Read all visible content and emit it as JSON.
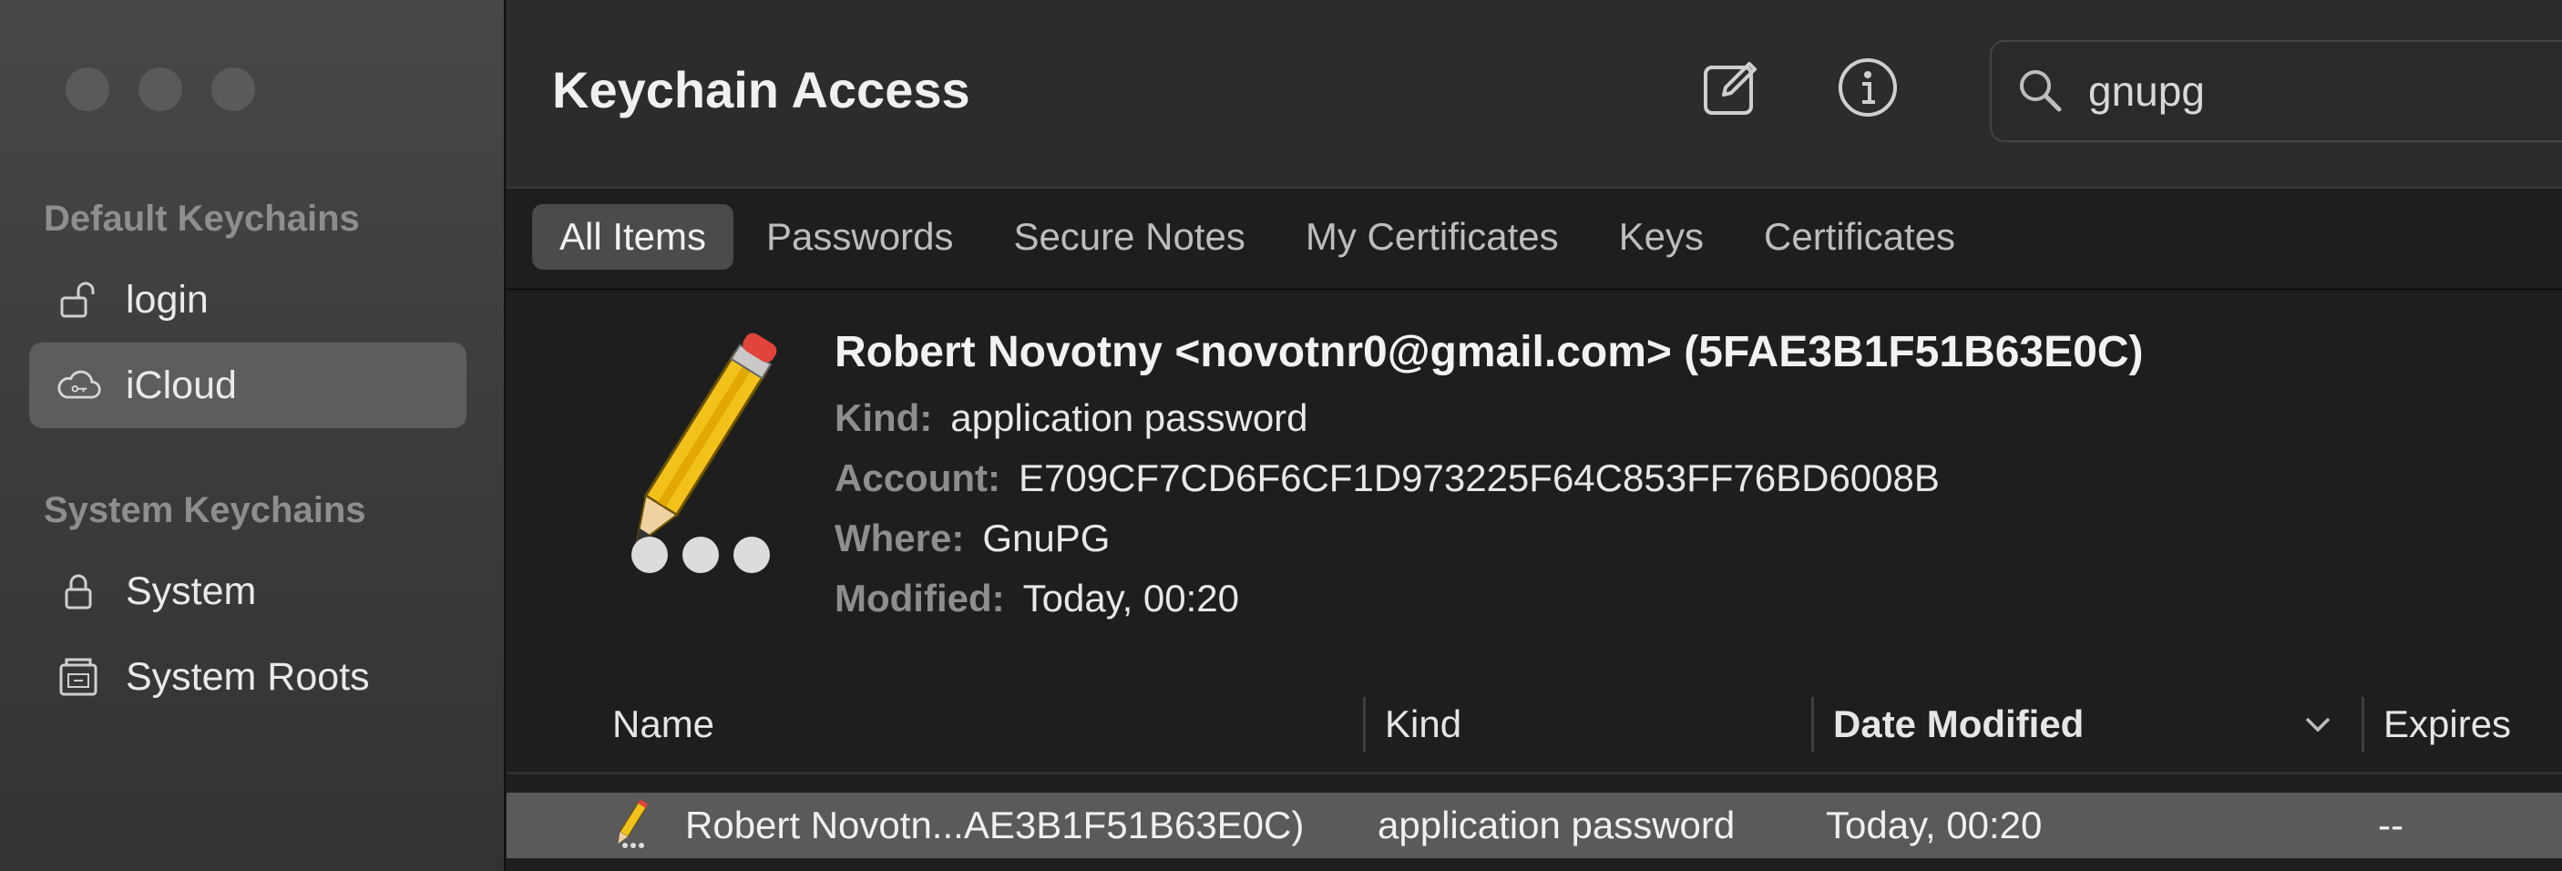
{
  "window": {
    "traffic_lights": [
      "close",
      "minimize",
      "zoom"
    ]
  },
  "sidebar": {
    "default_heading": "Default Keychains",
    "default_items": [
      {
        "label": "login",
        "icon": "lock-open-icon"
      },
      {
        "label": "iCloud",
        "icon": "cloud-icon",
        "selected": true
      }
    ],
    "system_heading": "System Keychains",
    "system_items": [
      {
        "label": "System",
        "icon": "lock-icon"
      },
      {
        "label": "System Roots",
        "icon": "cabinet-icon"
      }
    ]
  },
  "toolbar": {
    "title": "Keychain Access",
    "new_item_icon": "compose-icon",
    "info_icon": "info-icon",
    "search_value": "gnupg"
  },
  "tabs": [
    {
      "label": "All Items",
      "active": true
    },
    {
      "label": "Passwords"
    },
    {
      "label": "Secure Notes"
    },
    {
      "label": "My Certificates"
    },
    {
      "label": "Keys"
    },
    {
      "label": "Certificates"
    }
  ],
  "detail": {
    "title": "Robert Novotny <novotnr0@gmail.com> (5FAE3B1F51B63E0C)",
    "kind_label": "Kind:",
    "kind_value": "application password",
    "account_label": "Account:",
    "account_value": "E709CF7CD6F6CF1D973225F64C853FF76BD6008B",
    "where_label": "Where:",
    "where_value": "GnuPG",
    "modified_label": "Modified:",
    "modified_value": "Today, 00:20"
  },
  "table": {
    "columns": [
      "Name",
      "Kind",
      "Date Modified",
      "Expires"
    ],
    "sorted_column": "Date Modified",
    "rows": [
      {
        "name": "Robert Novotn...AE3B1F51B63E0C)",
        "kind": "application password",
        "date_modified": "Today, 00:20",
        "expires": "--"
      }
    ]
  }
}
